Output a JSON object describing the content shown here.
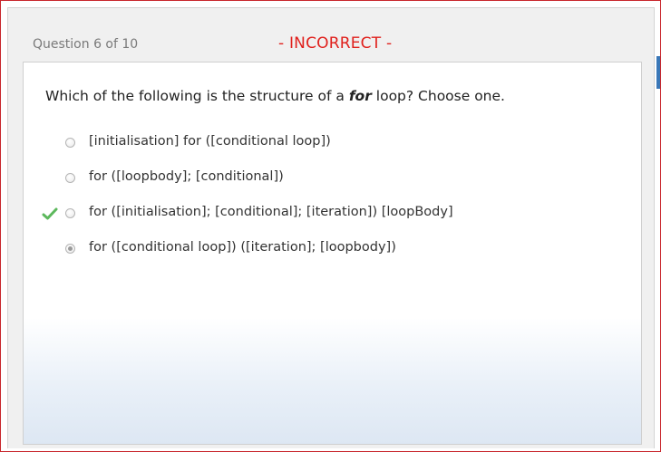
{
  "header": {
    "question_counter": "Question 6 of 10",
    "result": "- INCORRECT -"
  },
  "question": {
    "prefix": "Which of the following is the structure of a ",
    "emphasis": "for",
    "suffix": " loop? Choose one."
  },
  "options": [
    {
      "label": "[initialisation] for ([conditional loop])",
      "selected": false,
      "correct": false
    },
    {
      "label": "for ([loopbody]; [conditional])",
      "selected": false,
      "correct": false
    },
    {
      "label": "for ([initialisation]; [conditional]; [iteration]) [loopBody]",
      "selected": false,
      "correct": true
    },
    {
      "label": "for ([conditional loop]) ([iteration]; [loopbody])",
      "selected": true,
      "correct": false
    }
  ],
  "colors": {
    "incorrect": "#e0201c",
    "correct_check": "#5cb85c",
    "frame_border": "#c8262c",
    "accent": "#3a78b8"
  },
  "icons": {
    "correct_marker": "check-icon"
  }
}
